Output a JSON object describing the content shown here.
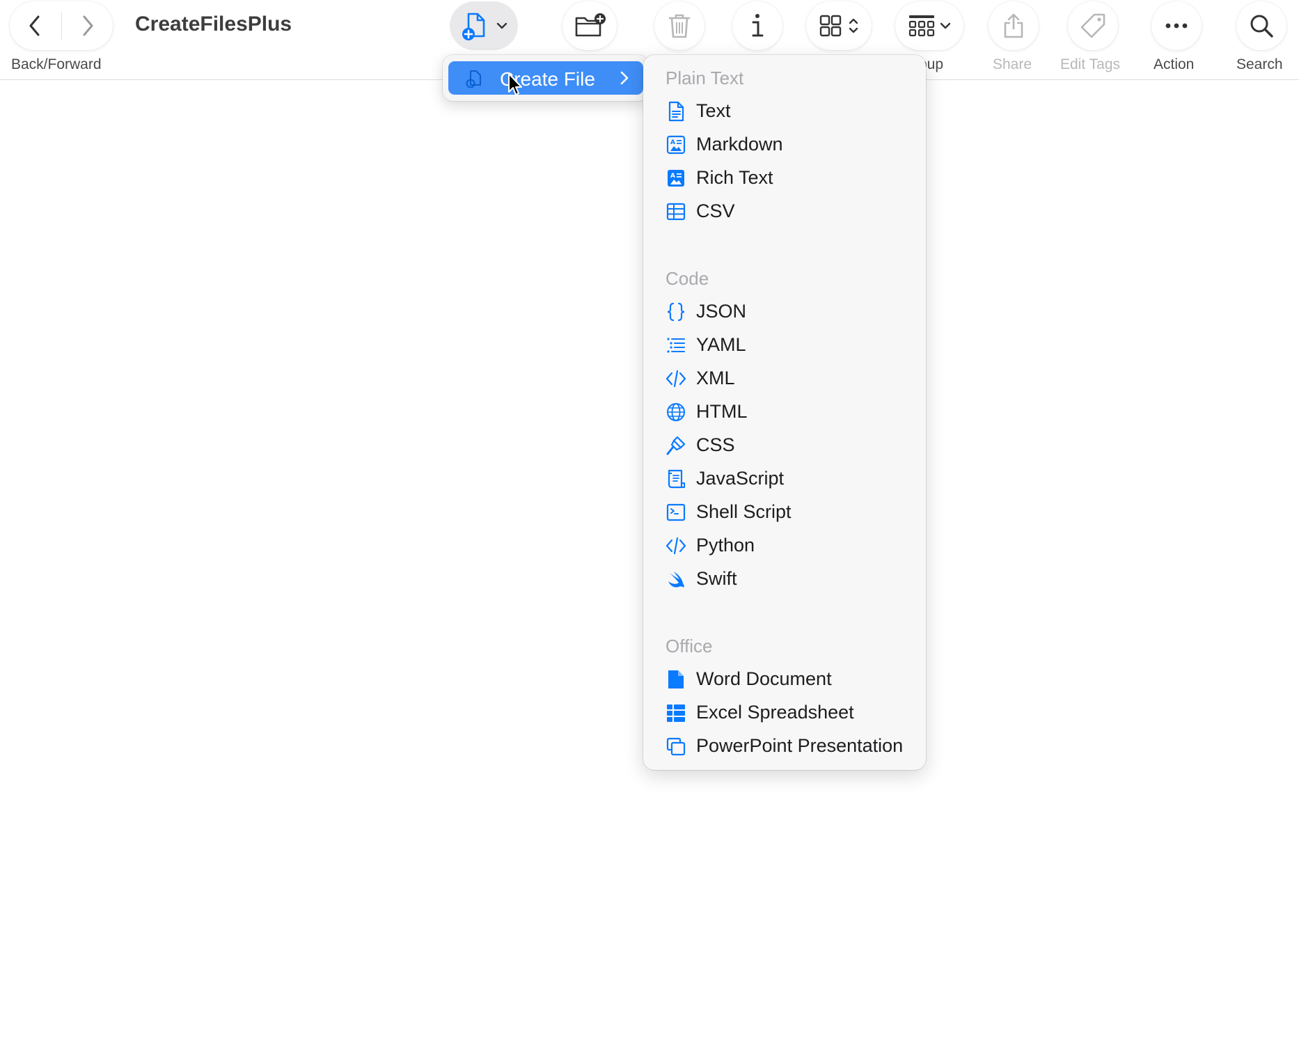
{
  "window": {
    "title": "CreateFilesPlus"
  },
  "toolbar": {
    "nav_label": "Back/Forward",
    "group_label_fragment": "oup",
    "share_label": "Share",
    "edit_tags_label": "Edit Tags",
    "action_label": "Action",
    "search_label": "Search"
  },
  "create_menu": {
    "item_label": "Create File"
  },
  "submenu": {
    "sections": [
      {
        "header": "Plain Text",
        "items": [
          {
            "label": "Text",
            "icon": "doc-text-icon"
          },
          {
            "label": "Markdown",
            "icon": "markdown-icon"
          },
          {
            "label": "Rich Text",
            "icon": "rich-text-icon"
          },
          {
            "label": "CSV",
            "icon": "table-icon"
          }
        ]
      },
      {
        "header": "Code",
        "items": [
          {
            "label": "JSON",
            "icon": "curly-braces-icon"
          },
          {
            "label": "YAML",
            "icon": "list-indent-icon"
          },
          {
            "label": "XML",
            "icon": "code-brackets-icon"
          },
          {
            "label": "HTML",
            "icon": "globe-icon"
          },
          {
            "label": "CSS",
            "icon": "paintbrush-icon"
          },
          {
            "label": "JavaScript",
            "icon": "scroll-icon"
          },
          {
            "label": "Shell Script",
            "icon": "terminal-icon"
          },
          {
            "label": "Python",
            "icon": "code-brackets-icon"
          },
          {
            "label": "Swift",
            "icon": "swift-icon"
          }
        ]
      },
      {
        "header": "Office",
        "items": [
          {
            "label": "Word Document",
            "icon": "doc-fill-icon"
          },
          {
            "label": "Excel Spreadsheet",
            "icon": "grid-fill-icon"
          },
          {
            "label": "PowerPoint Presentation",
            "icon": "slides-icon"
          }
        ]
      }
    ]
  },
  "colors": {
    "accent": "#0a7aff",
    "highlight": "#3f8ef7",
    "menu_bg": "#f7f7f8",
    "header_text": "#a9a9ae"
  }
}
